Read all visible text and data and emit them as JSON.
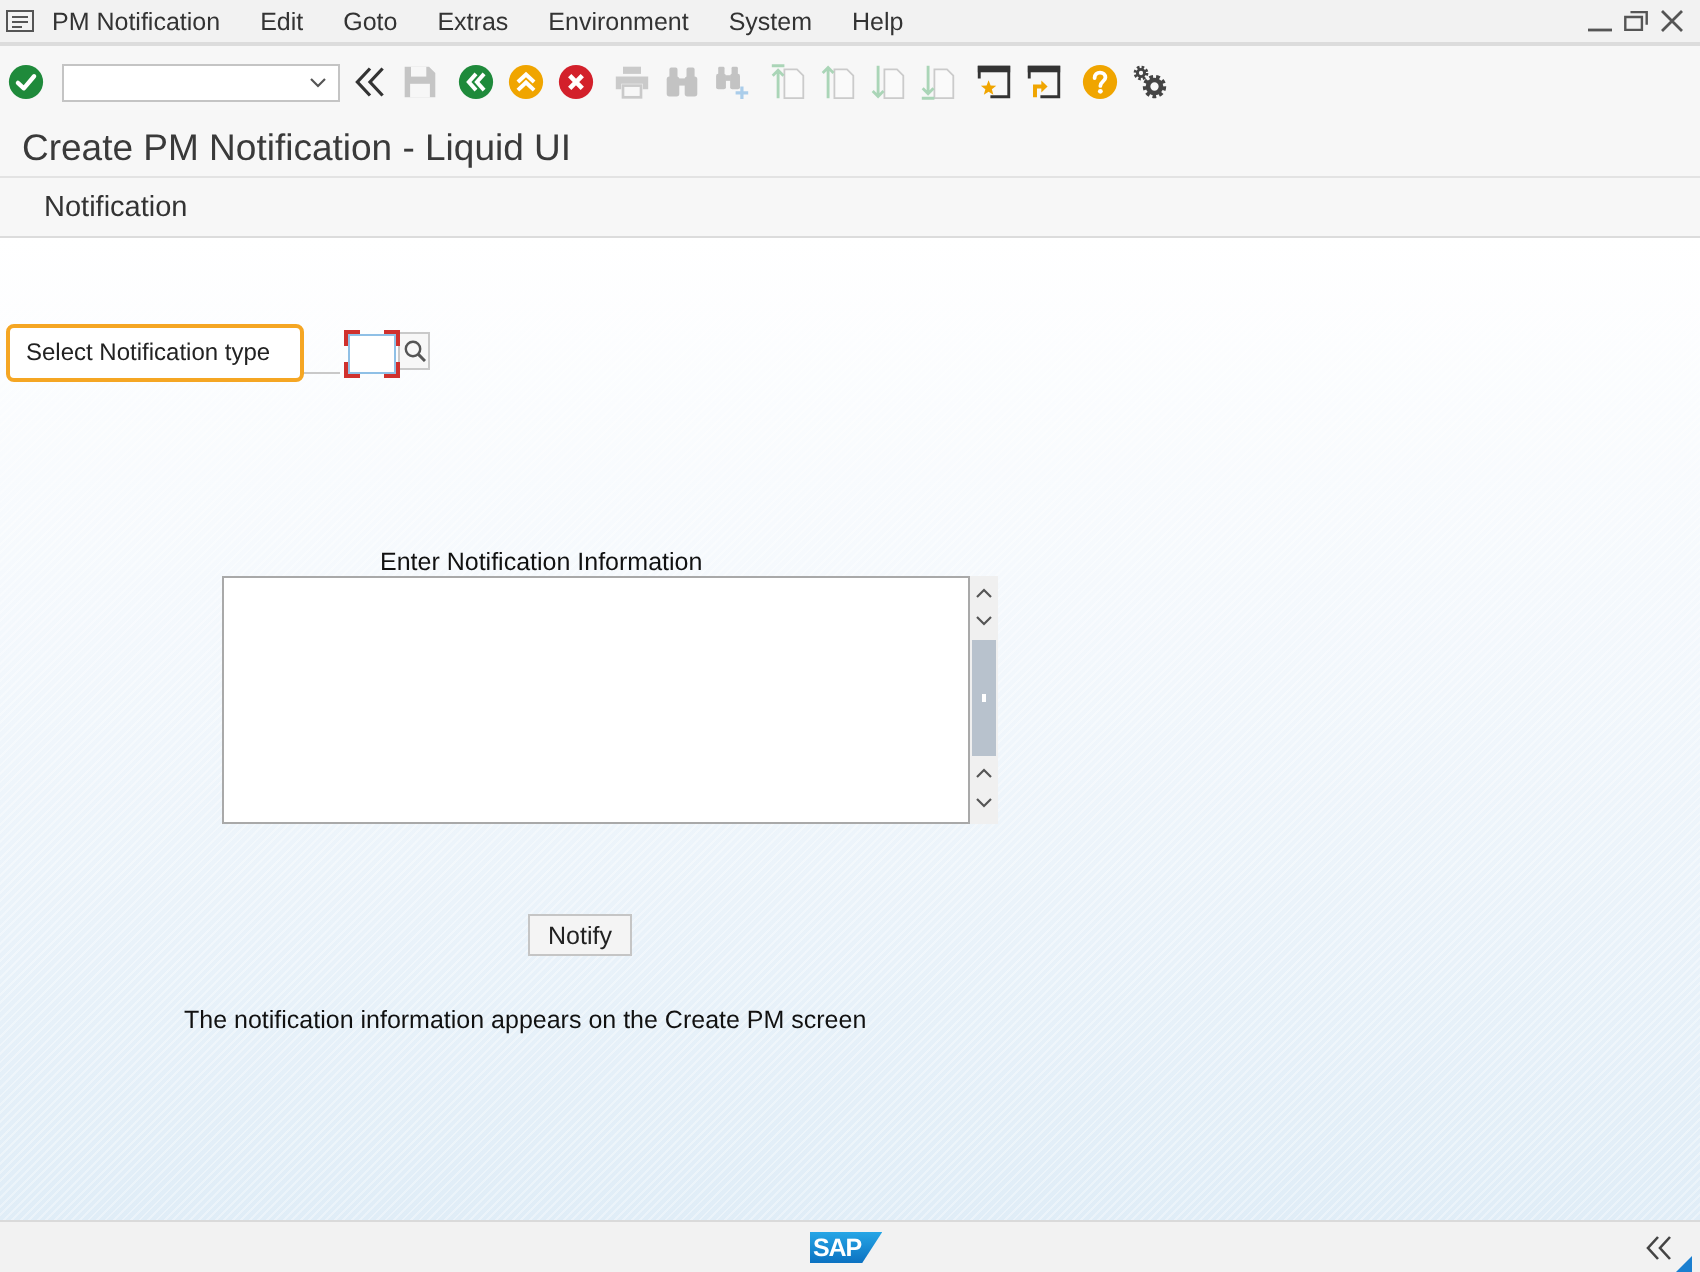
{
  "menu_bar": {
    "items": [
      "PM Notification",
      "Edit",
      "Goto",
      "Extras",
      "Environment",
      "System",
      "Help"
    ]
  },
  "toolbar": {
    "groups": [
      {
        "buttons": [
          {
            "kind": "enter",
            "disabled": false
          }
        ]
      },
      {
        "buttons": [
          {
            "kind": "hide-command-field",
            "disabled": false
          },
          {
            "kind": "save",
            "disabled": true
          }
        ]
      },
      {
        "buttons": [
          {
            "kind": "back",
            "disabled": false
          },
          {
            "kind": "exit",
            "disabled": false
          },
          {
            "kind": "cancel",
            "disabled": false
          }
        ]
      },
      {
        "buttons": [
          {
            "kind": "print",
            "disabled": true
          },
          {
            "kind": "find",
            "disabled": true
          },
          {
            "kind": "find-next",
            "disabled": true
          }
        ]
      },
      {
        "buttons": [
          {
            "kind": "first-page",
            "disabled": true
          },
          {
            "kind": "previous-page",
            "disabled": true
          },
          {
            "kind": "next-page",
            "disabled": true
          },
          {
            "kind": "last-page",
            "disabled": true
          }
        ]
      },
      {
        "buttons": [
          {
            "kind": "new-session",
            "disabled": false
          },
          {
            "kind": "shortcut",
            "disabled": false
          }
        ]
      },
      {
        "buttons": [
          {
            "kind": "help",
            "disabled": false
          },
          {
            "kind": "settings",
            "disabled": false
          }
        ]
      }
    ]
  },
  "title": "Create PM Notification - Liquid UI",
  "application_toolbar": {
    "buttons": [
      "Notification"
    ]
  },
  "form": {
    "type_label": {
      "text": "Select Notification type",
      "highlighted": true
    },
    "type_field": {
      "required": true
    },
    "info_label": "Enter Notification Information",
    "button": "Notify",
    "note": "The notification information appears on the Create PM screen"
  },
  "status_bar": {
    "logo": "SAP"
  }
}
